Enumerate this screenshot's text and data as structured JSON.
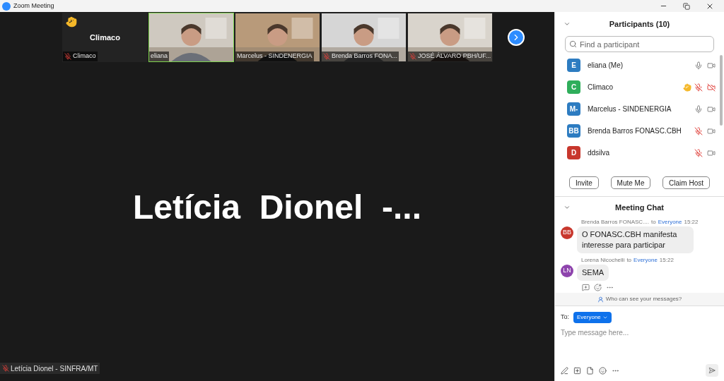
{
  "window": {
    "title": "Zoom Meeting"
  },
  "tiles": [
    {
      "name": "Climaco",
      "kind": "name",
      "hand": true,
      "muted": true,
      "selected": false,
      "big_label": "Climaco"
    },
    {
      "name": "eliana",
      "kind": "video",
      "hand": false,
      "muted": false,
      "selected": true
    },
    {
      "name": "Marcelus - SINDENERGIA",
      "kind": "video",
      "hand": false,
      "muted": false,
      "selected": false
    },
    {
      "name": "Brenda Barros FONA...",
      "kind": "video",
      "hand": false,
      "muted": true,
      "selected": false
    },
    {
      "name": "JOSÉ ÁLVARO PBH/UF...",
      "kind": "video",
      "hand": false,
      "muted": true,
      "selected": false
    }
  ],
  "speaker": {
    "big_name": "Letícia  Dionel  -...",
    "label": "Letícia Dionel - SINFRA/MT",
    "muted": true
  },
  "participants_panel": {
    "title": "Participants (10)",
    "search": {
      "placeholder": "Find a participant"
    },
    "participants": [
      {
        "name": "eliana (Me)",
        "initials": "E",
        "color": "#2d7cc1",
        "hand": false,
        "mic_muted": false,
        "video_off": false
      },
      {
        "name": "Climaco",
        "initials": "C",
        "color": "#2fae5b",
        "hand": true,
        "mic_muted": true,
        "video_off": true
      },
      {
        "name": "Marcelus - SINDENERGIA",
        "initials": "M-",
        "color": "#2d7cc1",
        "hand": false,
        "mic_muted": false,
        "video_off": false
      },
      {
        "name": "Brenda Barros FONASC.CBH",
        "initials": "BB",
        "color": "#2d7cc1",
        "hand": false,
        "mic_muted": true,
        "video_off": false
      },
      {
        "name": "ddsilva",
        "initials": "D",
        "color": "#c8372d",
        "hand": false,
        "mic_muted": true,
        "video_off": false
      }
    ],
    "buttons": [
      "Invite",
      "Mute Me",
      "Claim Host"
    ]
  },
  "chat": {
    "title": "Meeting Chat",
    "messages": [
      {
        "sender": "Brenda Barros FONASC....",
        "to_label": "to",
        "to": "Everyone",
        "time": "15:22",
        "initials": "BB",
        "color": "#c8372d",
        "text": "O FONASC.CBH manifesta interesse para participar"
      },
      {
        "sender": "Lorena Nicochelli",
        "to_label": "to",
        "to": "Everyone",
        "time": "15:22",
        "initials": "LN",
        "color": "#8e44ad",
        "text": "SEMA"
      }
    ],
    "privacy": "Who can see your messages?",
    "to_label": "To:",
    "recipient": "Everyone",
    "composer": {
      "placeholder": "Type message here..."
    }
  }
}
